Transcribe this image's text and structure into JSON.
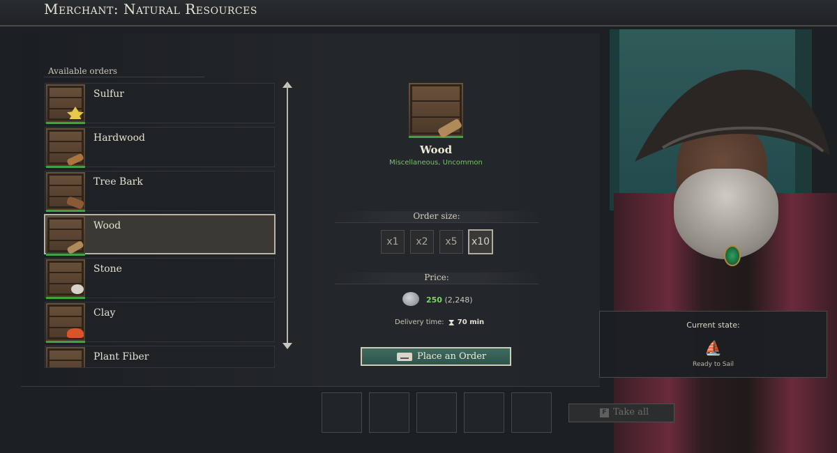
{
  "window": {
    "title": "Merchant: Natural Resources"
  },
  "orders": {
    "header": "Available orders",
    "items": [
      {
        "label": "Sulfur",
        "icon": "sulfur-icon",
        "color": "#e6c94a"
      },
      {
        "label": "Hardwood",
        "icon": "hardwood-icon",
        "color": "#a8753e"
      },
      {
        "label": "Tree Bark",
        "icon": "tree-bark-icon",
        "color": "#8a5a36"
      },
      {
        "label": "Wood",
        "icon": "wood-icon",
        "color": "#b08a5a",
        "selected": true
      },
      {
        "label": "Stone",
        "icon": "stone-icon",
        "color": "#d8d2c8"
      },
      {
        "label": "Clay",
        "icon": "clay-icon",
        "color": "#d8552c"
      },
      {
        "label": "Plant Fiber",
        "icon": "plant-fiber-icon",
        "color": "#7a9a4a"
      }
    ]
  },
  "detail": {
    "name": "Wood",
    "subtitle": "Miscellaneous, Uncommon",
    "order_size_label": "Order size:",
    "sizes": [
      "x1",
      "x2",
      "x5",
      "x10"
    ],
    "selected_size": "x10",
    "price_label": "Price:",
    "price_value": "250",
    "price_total": "(2,248)",
    "delivery_label": "Delivery time:",
    "delivery_value": "70 min",
    "place_order_label": "Place an Order"
  },
  "take_all": {
    "key": "F",
    "label": "Take all"
  },
  "current_state": {
    "title": "Current state:",
    "value": "Ready to Sail",
    "icon": "ship-icon"
  },
  "colors": {
    "accent_green": "#7ed36a",
    "button_teal": "#3f6a5f",
    "rarity_green": "#3fa33f"
  }
}
